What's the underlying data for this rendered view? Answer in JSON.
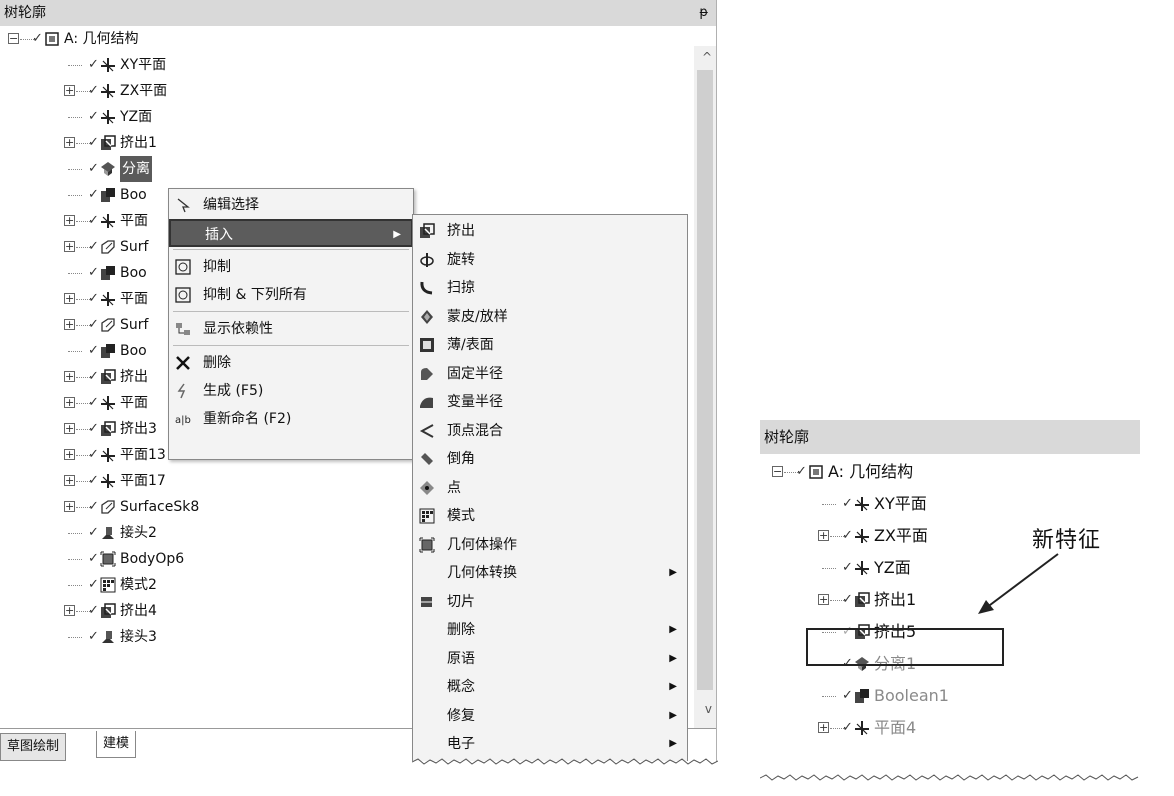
{
  "left": {
    "title": "树轮廓",
    "pin": "ᵽ",
    "tree": [
      {
        "label": "A: 几何结构",
        "icon": "geometry-icon",
        "expander": "−",
        "indent": 0
      },
      {
        "label": "XY平面",
        "icon": "plane-icon",
        "expander": "",
        "indent": 1
      },
      {
        "label": "ZX平面",
        "icon": "plane-icon",
        "expander": "+",
        "indent": 1
      },
      {
        "label": "YZ面",
        "icon": "plane-icon",
        "expander": "",
        "indent": 1
      },
      {
        "label": "挤出1",
        "icon": "extrude-icon",
        "expander": "+",
        "indent": 1
      },
      {
        "label": "分离",
        "icon": "separate-icon",
        "expander": "",
        "indent": 1,
        "selected": true
      },
      {
        "label": "Boo",
        "icon": "boolean-icon",
        "expander": "",
        "indent": 1
      },
      {
        "label": "平面",
        "icon": "plane-icon",
        "expander": "+",
        "indent": 1
      },
      {
        "label": "Surf",
        "icon": "surface-icon",
        "expander": "+",
        "indent": 1
      },
      {
        "label": "Boo",
        "icon": "boolean-icon",
        "expander": "",
        "indent": 1
      },
      {
        "label": "平面",
        "icon": "plane-icon",
        "expander": "+",
        "indent": 1
      },
      {
        "label": "Surf",
        "icon": "surface-icon",
        "expander": "+",
        "indent": 1
      },
      {
        "label": "Boo",
        "icon": "boolean-icon",
        "expander": "",
        "indent": 1
      },
      {
        "label": "挤出",
        "icon": "extrude-icon",
        "expander": "+",
        "indent": 1
      },
      {
        "label": "平面",
        "icon": "plane-icon",
        "expander": "+",
        "indent": 1
      },
      {
        "label": "挤出3",
        "icon": "extrude-icon",
        "expander": "+",
        "indent": 1
      },
      {
        "label": "平面13",
        "icon": "plane-icon",
        "expander": "+",
        "indent": 1
      },
      {
        "label": "平面17",
        "icon": "plane-icon",
        "expander": "+",
        "indent": 1
      },
      {
        "label": "SurfaceSk8",
        "icon": "surface-icon",
        "expander": "+",
        "indent": 1
      },
      {
        "label": "接头2",
        "icon": "joint-icon",
        "expander": "",
        "indent": 1
      },
      {
        "label": "BodyOp6",
        "icon": "bodyop-icon",
        "expander": "",
        "indent": 1
      },
      {
        "label": "模式2",
        "icon": "pattern-icon",
        "expander": "",
        "indent": 1
      },
      {
        "label": "挤出4",
        "icon": "extrude-icon",
        "expander": "+",
        "indent": 1
      },
      {
        "label": "接头3",
        "icon": "joint-icon",
        "expander": "",
        "indent": 1
      }
    ],
    "tabs": [
      "草图绘制",
      "建模"
    ],
    "scroll_up": "^",
    "scroll_down": "v"
  },
  "context_menu": {
    "items": [
      {
        "label": "编辑选择",
        "icon": "edit-select-icon",
        "type": "item"
      },
      {
        "label": "插入",
        "icon": "",
        "type": "item",
        "highlight": true,
        "arrow": "▶"
      },
      {
        "type": "sep"
      },
      {
        "label": "抑制",
        "icon": "suppress-icon",
        "type": "item"
      },
      {
        "label": "抑制 & 下列所有",
        "icon": "suppress-icon",
        "type": "item"
      },
      {
        "type": "sep"
      },
      {
        "label": "显示依赖性",
        "icon": "dependency-icon",
        "type": "item"
      },
      {
        "type": "sep"
      },
      {
        "label": "删除",
        "icon": "delete-icon",
        "type": "item"
      },
      {
        "label": "生成 (F5)",
        "icon": "generate-icon",
        "type": "item"
      },
      {
        "label": "重新命名 (F2)",
        "icon": "rename-icon",
        "type": "item"
      }
    ]
  },
  "insert_menu": {
    "items": [
      {
        "label": "挤出",
        "icon": "extrude-icon"
      },
      {
        "label": "旋转",
        "icon": "revolve-icon"
      },
      {
        "label": "扫掠",
        "icon": "sweep-icon"
      },
      {
        "label": "蒙皮/放样",
        "icon": "skin-loft-icon"
      },
      {
        "label": "薄/表面",
        "icon": "thin-surface-icon"
      },
      {
        "label": "固定半径",
        "icon": "fixed-radius-icon"
      },
      {
        "label": "变量半径",
        "icon": "variable-radius-icon"
      },
      {
        "label": "顶点混合",
        "icon": "vertex-blend-icon"
      },
      {
        "label": "倒角",
        "icon": "chamfer-icon"
      },
      {
        "label": "点",
        "icon": "point-icon"
      },
      {
        "label": "模式",
        "icon": "pattern-icon"
      },
      {
        "label": "几何体操作",
        "icon": "bodyop-icon"
      },
      {
        "label": "几何体转换",
        "icon": "",
        "arrow": "▶"
      },
      {
        "label": "切片",
        "icon": "slice-icon"
      },
      {
        "label": "删除",
        "icon": "",
        "arrow": "▶"
      },
      {
        "label": "原语",
        "icon": "",
        "arrow": "▶"
      },
      {
        "label": "概念",
        "icon": "",
        "arrow": "▶"
      },
      {
        "label": "修复",
        "icon": "",
        "arrow": "▶"
      },
      {
        "label": "电子",
        "icon": "",
        "arrow": "▶"
      }
    ]
  },
  "right": {
    "title": "树轮廓",
    "callout": "新特征",
    "tree": [
      {
        "label": "A: 几何结构",
        "icon": "geometry-icon",
        "expander": "−",
        "indent": 0
      },
      {
        "label": "XY平面",
        "icon": "plane-icon",
        "expander": "",
        "indent": 1
      },
      {
        "label": "ZX平面",
        "icon": "plane-icon",
        "expander": "+",
        "indent": 1
      },
      {
        "label": "YZ面",
        "icon": "plane-icon",
        "expander": "",
        "indent": 1
      },
      {
        "label": "挤出1",
        "icon": "extrude-icon",
        "expander": "+",
        "indent": 1
      },
      {
        "label": "挤出5",
        "icon": "extrude-icon",
        "expander": "",
        "indent": 1,
        "boxed": true
      },
      {
        "label": "分离1",
        "icon": "separate-icon",
        "expander": "",
        "indent": 1,
        "grey": true
      },
      {
        "label": "Boolean1",
        "icon": "boolean-icon",
        "expander": "",
        "indent": 1,
        "grey": true
      },
      {
        "label": "平面4",
        "icon": "plane-icon",
        "expander": "+",
        "indent": 1,
        "grey": true
      }
    ]
  }
}
